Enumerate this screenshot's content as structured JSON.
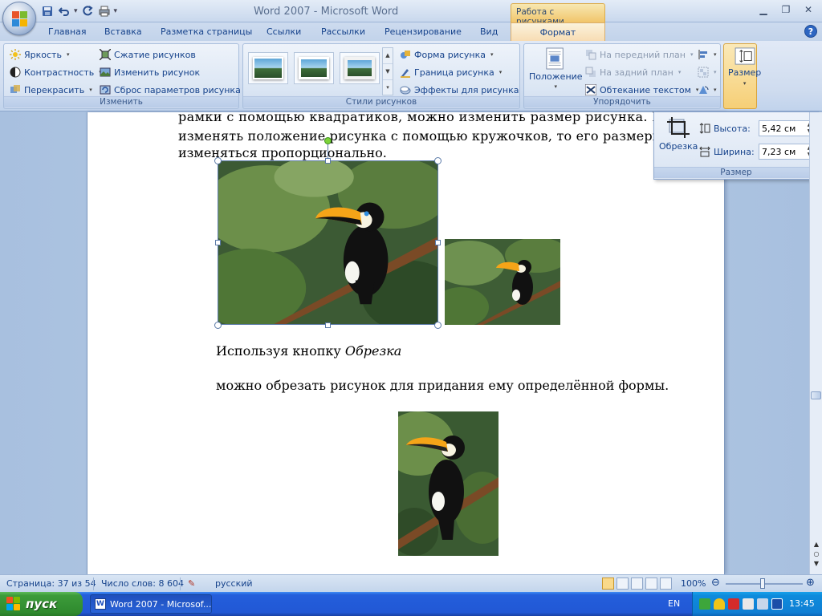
{
  "app": {
    "title": "Word 2007 - Microsoft Word",
    "contextual_header": "Работа с рисунками"
  },
  "tabs": [
    {
      "label": "Главная"
    },
    {
      "label": "Вставка"
    },
    {
      "label": "Разметка страницы"
    },
    {
      "label": "Ссылки"
    },
    {
      "label": "Рассылки"
    },
    {
      "label": "Рецензирование"
    },
    {
      "label": "Вид"
    },
    {
      "label": "Формат",
      "active": true
    }
  ],
  "ribbon": {
    "adjust": {
      "label": "Изменить",
      "brightness": "Яркость",
      "contrast": "Контрастность",
      "recolor": "Перекрасить",
      "compress": "Сжатие рисунков",
      "change": "Изменить рисунок",
      "reset": "Сброс параметров рисунка"
    },
    "styles": {
      "label": "Стили рисунков",
      "shape": "Форма рисунка",
      "border": "Граница рисунка",
      "effects": "Эффекты для рисунка"
    },
    "arrange": {
      "label": "Упорядочить",
      "position": "Положение",
      "bring_front": "На передний план",
      "send_back": "На задний план",
      "text_wrap": "Обтекание текстом"
    },
    "size_button": "Размер"
  },
  "size_popup": {
    "label": "Размер",
    "crop": "Обрезка",
    "height_label": "Высота:",
    "height_value": "5,42 см",
    "width_label": "Ширина:",
    "width_value": "7,23 см"
  },
  "document": {
    "line1": "рамки с помощью квадратиков, можно изменить размер рисунка. Если",
    "line2": "изменять положение рисунка с помощью кружочков, то его размеры будут",
    "line3": "изменяться пропорционально.",
    "para_crop_prefix": "Используя кнопку ",
    "para_crop_italic": "Обрезка",
    "para_crop_rest": "можно обрезать рисунок для придания ему определённой формы."
  },
  "status": {
    "page": "Страница: 37 из 54",
    "words": "Число слов: 8 604",
    "language": "русский",
    "zoom": "100%"
  },
  "taskbar": {
    "start": "пуск",
    "task": "Word 2007 - Microsof...",
    "lang": "EN",
    "clock": "13:45"
  },
  "colors": {
    "ribbon_bg": "#dbe6f4",
    "contextual_tab": "#f1c56a",
    "taskbar": "#245edb",
    "start_button": "#3c9b3a"
  }
}
